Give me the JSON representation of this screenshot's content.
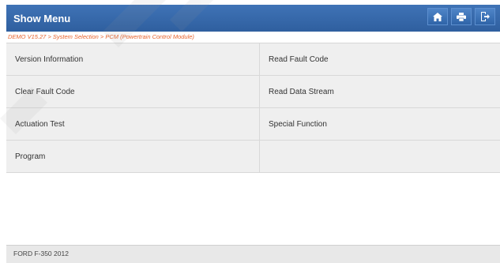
{
  "window": {
    "title": "Show Menu"
  },
  "toolbar": {
    "home_icon": "home-icon",
    "print_icon": "print-icon",
    "exit_icon": "exit-icon"
  },
  "breadcrumb": {
    "text": "DEMO V15.27 > System Selection > PCM (Powertrain Control Module)",
    "color": "#e8632c"
  },
  "menu": {
    "items": [
      {
        "label": "Version Information"
      },
      {
        "label": "Read Fault Code"
      },
      {
        "label": "Clear Fault Code"
      },
      {
        "label": "Read Data Stream"
      },
      {
        "label": "Actuation Test"
      },
      {
        "label": "Special Function"
      },
      {
        "label": "Program"
      },
      {
        "label": ""
      }
    ]
  },
  "footer": {
    "vehicle": "FORD F-350 2012"
  },
  "colors": {
    "titlebar": "#2f5f9f",
    "menu_bg": "#efefef"
  }
}
